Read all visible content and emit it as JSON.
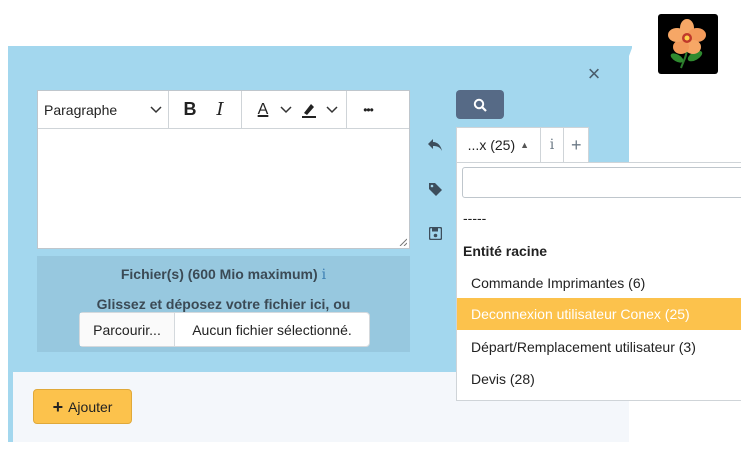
{
  "editor": {
    "paragraph_label": "Paragraphe",
    "bold_label": "B",
    "italic_label": "I",
    "font_color_label": "A",
    "more_label": "•••"
  },
  "files": {
    "title": "Fichier(s) (600 Mio maximum)",
    "info": "i",
    "drop_text": "Glissez et déposez votre fichier ici, ou",
    "browse_label": "Parcourir...",
    "no_file_label": "Aucun fichier sélectionné."
  },
  "footer": {
    "add_label": "Ajouter",
    "add_plus": "+"
  },
  "dropdown": {
    "selected": "...x (25)",
    "info": "i",
    "plus": "+",
    "items": [
      {
        "label": "-----"
      },
      {
        "label": "Entité racine"
      },
      {
        "label": "Commande Imprimantes (6)"
      },
      {
        "label": "Deconnexion utilisateur Conex (25)"
      },
      {
        "label": "Départ/Remplacement utilisateur (3)"
      },
      {
        "label": "Devis (28)"
      }
    ]
  },
  "colors": {
    "panel": "#a3d7ee",
    "accent": "#fcc24c",
    "search_button": "#566a86"
  }
}
